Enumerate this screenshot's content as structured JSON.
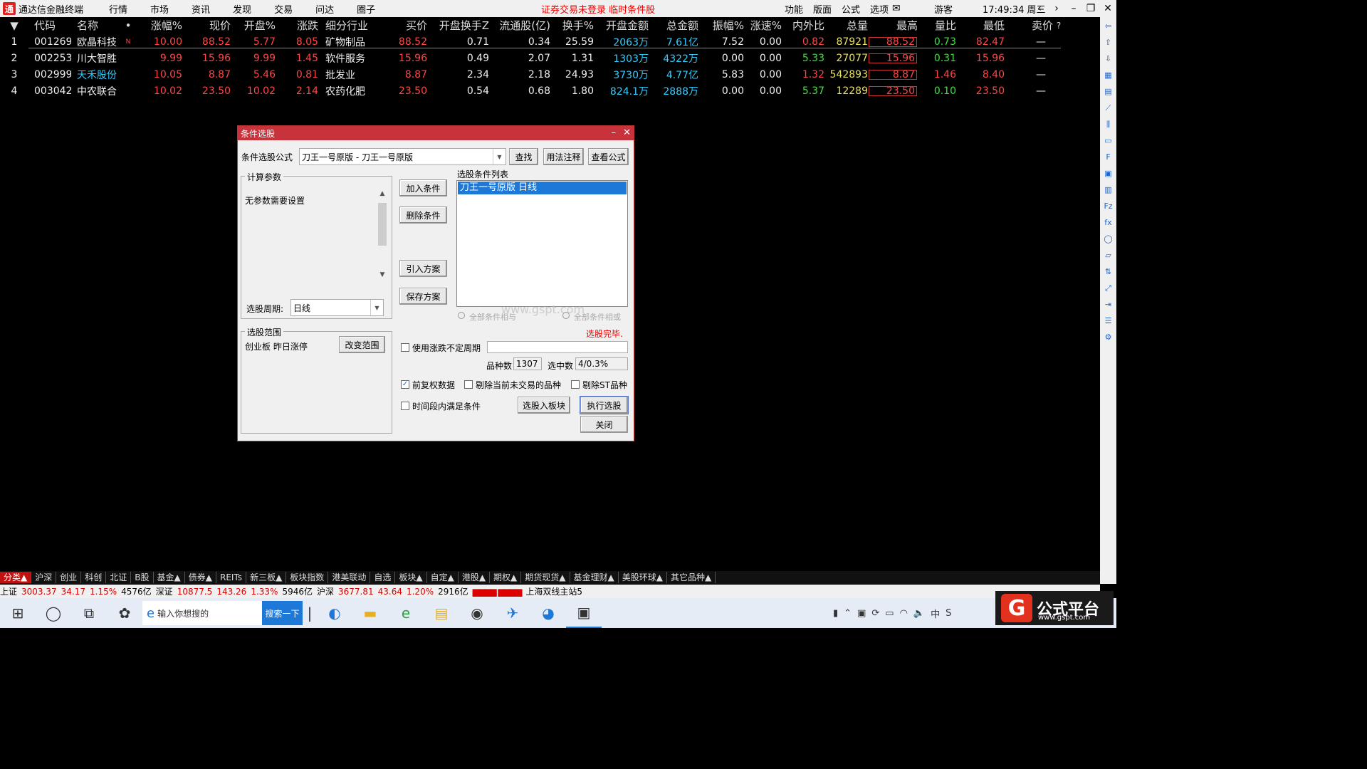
{
  "titlebar": {
    "app_name": "通达信金融终端",
    "menu": [
      "行情",
      "市场",
      "资讯",
      "发现",
      "交易",
      "问达",
      "圈子"
    ],
    "center_msg": "证券交易未登录  临时条件股",
    "right_menu": [
      "功能",
      "版面",
      "公式",
      "选项"
    ],
    "guest": "游客",
    "clock": "17:49:34 周三"
  },
  "table": {
    "headers": [
      "代码",
      "名称",
      "•",
      "涨幅%",
      "现价",
      "开盘%",
      "涨跌",
      "细分行业",
      "买价",
      "开盘换手Z",
      "流通股(亿)",
      "换手%",
      "开盘金额",
      "总金额",
      "振幅%",
      "涨速%",
      "内外比",
      "总量",
      "最高",
      "量比",
      "最低",
      "卖价",
      "?"
    ],
    "rows": [
      {
        "idx": "1",
        "code": "001269",
        "name": "欧晶科技",
        "flag": "N",
        "chg": "10.00",
        "price": "88.52",
        "open_pct": "5.77",
        "diff": "8.05",
        "industry": "矿物制品",
        "bid": "88.52",
        "open_turn": "0.71",
        "float": "0.34",
        "turn": "25.59",
        "open_amt": "2063万",
        "amt": "7.61亿",
        "amp": "7.52",
        "speed": "0.00",
        "io": "0.82",
        "vol": "87921",
        "high": "88.52",
        "vr": "0.73",
        "low": "82.47",
        "ask": "—"
      },
      {
        "idx": "2",
        "code": "002253",
        "name": "川大智胜",
        "flag": "",
        "chg": "9.99",
        "price": "15.96",
        "open_pct": "9.99",
        "diff": "1.45",
        "industry": "软件服务",
        "bid": "15.96",
        "open_turn": "0.49",
        "float": "2.07",
        "turn": "1.31",
        "open_amt": "1303万",
        "amt": "4322万",
        "amp": "0.00",
        "speed": "0.00",
        "io": "5.33",
        "vol": "27077",
        "high": "15.96",
        "vr": "0.31",
        "low": "15.96",
        "ask": "—"
      },
      {
        "idx": "3",
        "code": "002999",
        "name": "天禾股份",
        "flag": "",
        "chg": "10.05",
        "price": "8.87",
        "open_pct": "5.46",
        "diff": "0.81",
        "industry": "批发业",
        "bid": "8.87",
        "open_turn": "2.34",
        "float": "2.18",
        "turn": "24.93",
        "open_amt": "3730万",
        "amt": "4.77亿",
        "amp": "5.83",
        "speed": "0.00",
        "io": "1.32",
        "vol": "542893",
        "high": "8.87",
        "vr": "1.46",
        "low": "8.40",
        "ask": "—"
      },
      {
        "idx": "4",
        "code": "003042",
        "name": "中农联合",
        "flag": "",
        "chg": "10.02",
        "price": "23.50",
        "open_pct": "10.02",
        "diff": "2.14",
        "industry": "农药化肥",
        "bid": "23.50",
        "open_turn": "0.54",
        "float": "0.68",
        "turn": "1.80",
        "open_amt": "824.1万",
        "amt": "2888万",
        "amp": "0.00",
        "speed": "0.00",
        "io": "5.37",
        "vol": "12289",
        "high": "23.50",
        "vr": "0.10",
        "low": "23.50",
        "ask": "—"
      }
    ]
  },
  "dialog": {
    "title": "条件选股",
    "formula_label": "条件选股公式",
    "formula_value": "刀王一号原版 - 刀王一号原版",
    "btn_find": "查找",
    "btn_usage": "用法注释",
    "btn_view": "查看公式",
    "params_group": "计算参数",
    "params_text": "无参数需要设置",
    "period_label": "选股周期:",
    "period_value": "日线",
    "btn_add": "加入条件",
    "btn_delete": "删除条件",
    "btn_import": "引入方案",
    "btn_save": "保存方案",
    "list_label": "选股条件列表",
    "list_items": [
      "刀王一号原版  日线"
    ],
    "radio_and": "全部条件相与",
    "radio_or": "全部条件相或",
    "status": "选股完毕.",
    "watermark_text": "www.gspt.com",
    "range_group": "选股范围",
    "range_text": "创业板 昨日涨停",
    "btn_change_range": "改变范围",
    "chk_period": "使用涨跌不定周期",
    "count_label": "品种数",
    "count_value": "1307",
    "selected_label": "选中数",
    "selected_value": "4/0.3%",
    "chk_fq": "前复权数据",
    "chk_fq_checked": true,
    "chk_notrade": "剔除当前未交易的品种",
    "chk_st": "剔除ST品种",
    "chk_timerange": "时间段内满足条件",
    "btn_to_block": "选股入板块",
    "btn_execute": "执行选股",
    "btn_close": "关闭"
  },
  "tabs": [
    "分类▲",
    "沪深",
    "创业",
    "科创",
    "北证",
    "B股",
    "基金▲",
    "债券▲",
    "REITs",
    "新三板▲",
    "板块指数",
    "港美联动",
    "自选",
    "板块▲",
    "自定▲",
    "港股▲",
    "期权▲",
    "期货现货▲",
    "基金理财▲",
    "美股环球▲",
    "其它品种▲"
  ],
  "statusbar": {
    "sh_label": "上证",
    "sh_val": "3003.37",
    "sh_chg": "34.17",
    "sh_pct": "1.15%",
    "sh_amt": "4576亿",
    "sz_label": "深证",
    "sz_val": "10877.5",
    "sz_chg": "143.26",
    "sz_pct": "1.33%",
    "sz_amt": "5946亿",
    "hs_label": "沪深",
    "hs_val": "3677.81",
    "hs_chg": "43.64",
    "hs_pct": "1.20%",
    "hs_amt": "2916亿",
    "server": "上海双线主站5"
  },
  "taskbar": {
    "search_placeholder": "输入你想搜的",
    "search_btn": "搜索一下"
  },
  "brand": {
    "name": "公式平台",
    "url": "www.gspt.com"
  }
}
